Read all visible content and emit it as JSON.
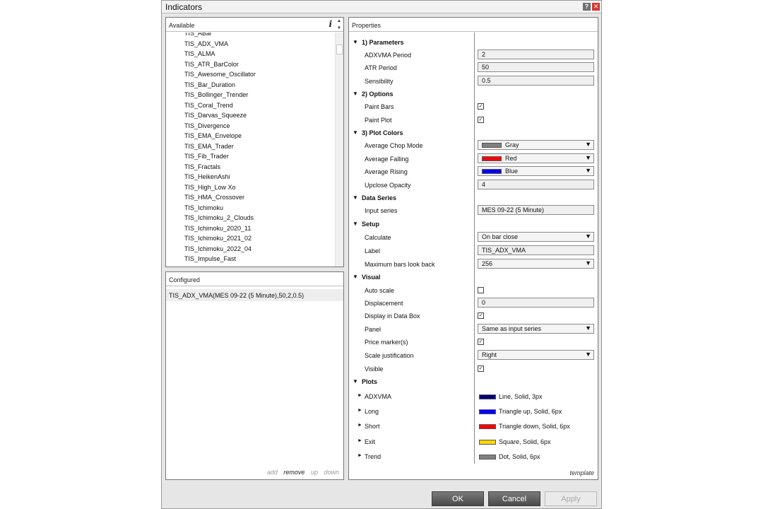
{
  "window": {
    "title": "Indicators",
    "help_glyph": "?",
    "close_glyph": "✕"
  },
  "available": {
    "header": "Available",
    "info_glyph": "i",
    "items": [
      "TIS_ABar",
      "TIS_ADX_VMA",
      "TIS_ALMA",
      "TIS_ATR_BarColor",
      "TIS_Awesome_Oscillator",
      "TIS_Bar_Duration",
      "TIS_Bollinger_Trender",
      "TIS_Coral_Trend",
      "TIS_Darvas_Squeeze",
      "TIS_Divergence",
      "TIS_EMA_Envelope",
      "TIS_EMA_Trader",
      "TIS_Fib_Trader",
      "TIS_Fractals",
      "TIS_HeikenAshi",
      "TIS_High_Low Xo",
      "TIS_HMA_Crossover",
      "TIS_Ichimoku",
      "TIS_Ichimoku_2_Clouds",
      "TIS_Ichimoku_2020_11",
      "TIS_Ichimoku_2021_02",
      "TIS_Ichimoku_2022_04",
      "TIS_Impulse_Fast"
    ]
  },
  "configured": {
    "header": "Configured",
    "item": "TIS_ADX_VMA(MES 09-22 (5 Minute),50,2,0.5)",
    "actions": {
      "add": "add",
      "remove": "remove",
      "up": "up",
      "down": "down"
    }
  },
  "properties": {
    "header": "Properties",
    "template_link": "template",
    "sections": {
      "parameters": "1) Parameters",
      "options": "2) Options",
      "plot_colors": "3) Plot Colors",
      "data_series": "Data Series",
      "setup": "Setup",
      "visual": "Visual",
      "plots": "Plots"
    },
    "fields": {
      "adxvma_period": {
        "label": "ADXVMA Period",
        "value": "2"
      },
      "atr_period": {
        "label": "ATR Period",
        "value": "50"
      },
      "sensibility": {
        "label": "Sensibility",
        "value": "0.5"
      },
      "paint_bars": {
        "label": "Paint Bars",
        "checked": true,
        "mark": "✓"
      },
      "paint_plot": {
        "label": "Paint Plot",
        "checked": true,
        "mark": "✓"
      },
      "average_chop_mode": {
        "label": "Average Chop Mode",
        "value": "Gray",
        "color": "#808080"
      },
      "average_falling": {
        "label": "Average Falling",
        "value": "Red",
        "color": "#ff0000"
      },
      "average_rising": {
        "label": "Average Rising",
        "value": "Blue",
        "color": "#0000ff"
      },
      "upclose_opacity": {
        "label": "Upclose Opacity",
        "value": "4"
      },
      "input_series": {
        "label": "Input series",
        "value": "MES 09-22 (5 Minute)"
      },
      "calculate": {
        "label": "Calculate",
        "value": "On bar close"
      },
      "label": {
        "label": "Label",
        "value": "TIS_ADX_VMA"
      },
      "max_bars_look_back": {
        "label": "Maximum bars look back",
        "value": "256"
      },
      "auto_scale": {
        "label": "Auto scale",
        "checked": false,
        "mark": ""
      },
      "displacement": {
        "label": "Displacement",
        "value": "0"
      },
      "display_in_data_box": {
        "label": "Display in Data Box",
        "checked": true,
        "mark": "✓"
      },
      "panel": {
        "label": "Panel",
        "value": "Same as input series"
      },
      "price_markers": {
        "label": "Price marker(s)",
        "checked": true,
        "mark": "✓"
      },
      "scale_justification": {
        "label": "Scale justification",
        "value": "Right"
      },
      "visible": {
        "label": "Visible",
        "checked": true,
        "mark": "✓"
      }
    },
    "plots": [
      {
        "name": "ADXVMA",
        "style": "Line, Solid, 3px",
        "color": "#000080"
      },
      {
        "name": "Long",
        "style": "Triangle up, Solid, 6px",
        "color": "#0000ff"
      },
      {
        "name": "Short",
        "style": "Triangle down, Solid, 6px",
        "color": "#ff0000"
      },
      {
        "name": "Exit",
        "style": "Square, Solid, 6px",
        "color": "#ffd700"
      },
      {
        "name": "Trend",
        "style": "Dot, Solid, 6px",
        "color": "#808080"
      }
    ]
  },
  "buttons": {
    "ok": "OK",
    "cancel": "Cancel",
    "apply": "Apply"
  },
  "icons": {
    "section_caret": "▼",
    "plot_caret": "►",
    "dropdown_arrow": "▼",
    "scroll_up": "▲",
    "scroll_down": "▼"
  }
}
